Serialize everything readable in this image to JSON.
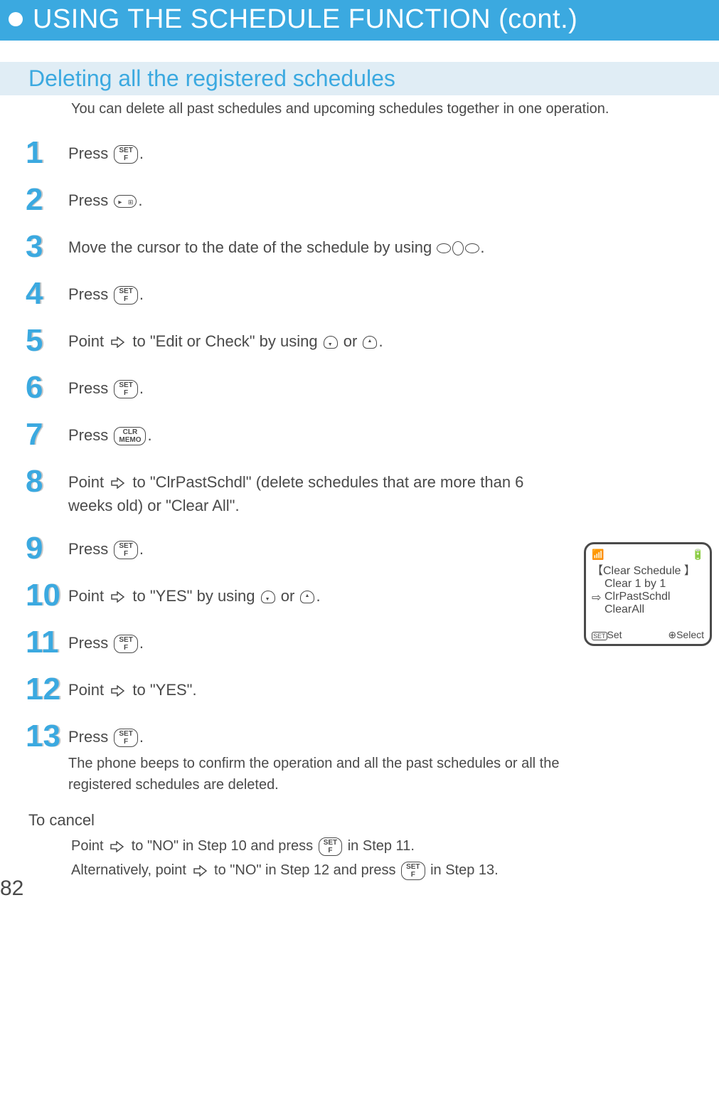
{
  "header": {
    "title": "USING THE SCHEDULE FUNCTION (cont.)"
  },
  "section": {
    "title": "Deleting all the registered schedules",
    "intro": "You can delete all past schedules and upcoming schedules together in one operation."
  },
  "buttons": {
    "set_top": "SET",
    "set_bottom": "F",
    "clr_top": "CLR",
    "clr_bottom": "MEMO"
  },
  "steps": [
    {
      "n": "1",
      "text_a": "Press ",
      "icon": "set",
      "text_b": "."
    },
    {
      "n": "2",
      "text_a": "Press ",
      "icon": "cal",
      "text_b": "."
    },
    {
      "n": "3",
      "text_a": "Move the cursor to the date of the schedule by using ",
      "icon": "nav",
      "text_b": "."
    },
    {
      "n": "4",
      "text_a": "Press ",
      "icon": "set",
      "text_b": "."
    },
    {
      "n": "5",
      "text_a": "Point ",
      "mid": " to \"Edit or Check\" by using ",
      "text_b": " or ",
      "text_c": "."
    },
    {
      "n": "6",
      "text_a": "Press ",
      "icon": "set",
      "text_b": "."
    },
    {
      "n": "7",
      "text_a": "Press ",
      "icon": "clr",
      "text_b": "."
    },
    {
      "n": "8",
      "text_a": "Point ",
      "mid": " to \"ClrPastSchdl\" (delete schedules that are more than 6 weeks old) or \"Clear All\"."
    },
    {
      "n": "9",
      "text_a": "Press ",
      "icon": "set",
      "text_b": "."
    },
    {
      "n": "10",
      "text_a": "Point ",
      "mid": " to \"YES\" by using ",
      "text_b": " or ",
      "text_c": "."
    },
    {
      "n": "11",
      "text_a": "Press ",
      "icon": "set",
      "text_b": "."
    },
    {
      "n": "12",
      "text_a": "Point ",
      "mid": " to \"YES\"."
    },
    {
      "n": "13",
      "text_a": "Press ",
      "icon": "set",
      "text_b": ".",
      "sub": "The phone beeps to confirm the operation and all the past schedules or all the registered schedules are deleted."
    }
  ],
  "screen": {
    "title": "【Clear Schedule 】",
    "item1": "Clear 1 by 1",
    "item2": "ClrPastSchdl",
    "item3": "ClearAll",
    "left": "Set",
    "right": "Select",
    "left_icon": "SET",
    "right_icon": "⊕"
  },
  "cancel": {
    "title": "To cancel",
    "line1a": "Point ",
    "line1b": " to \"NO\" in Step 10 and press ",
    "line1c": " in Step 11.",
    "line2a": "Alternatively, point ",
    "line2b": " to \"NO\" in Step 12 and press ",
    "line2c": " in Step 13."
  },
  "page": "82"
}
